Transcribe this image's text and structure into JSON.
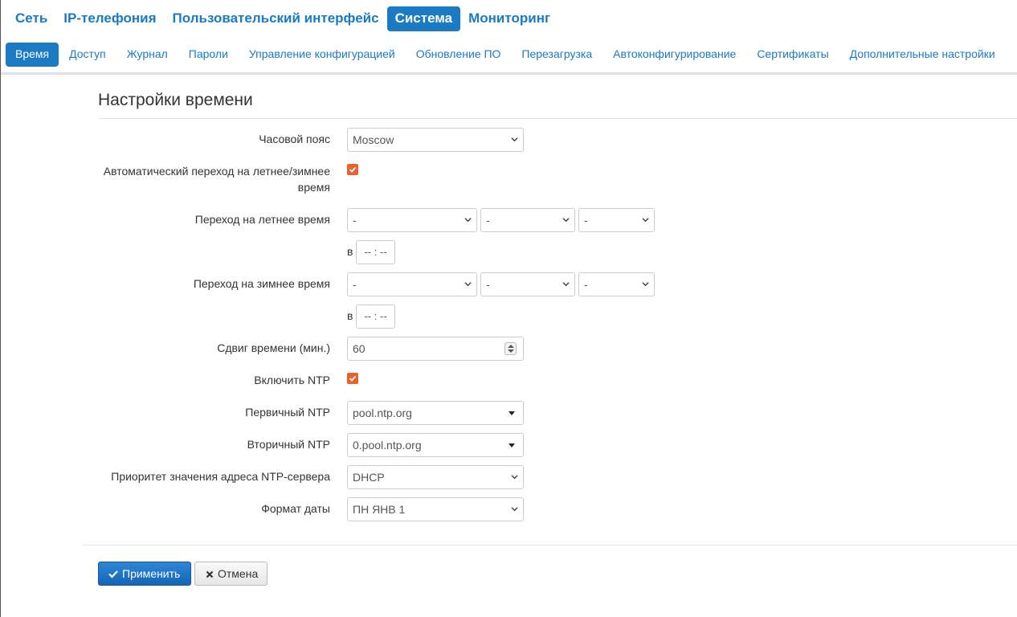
{
  "top_nav": [
    {
      "label": "Сеть",
      "active": false
    },
    {
      "label": "IP-телефония",
      "active": false
    },
    {
      "label": "Пользовательский интерфейс",
      "active": false
    },
    {
      "label": "Система",
      "active": true
    },
    {
      "label": "Мониторинг",
      "active": false
    }
  ],
  "sub_nav": [
    {
      "label": "Время",
      "active": true
    },
    {
      "label": "Доступ",
      "active": false
    },
    {
      "label": "Журнал",
      "active": false
    },
    {
      "label": "Пароли",
      "active": false
    },
    {
      "label": "Управление конфигурацией",
      "active": false
    },
    {
      "label": "Обновление ПО",
      "active": false
    },
    {
      "label": "Перезагрузка",
      "active": false
    },
    {
      "label": "Автоконфигурирование",
      "active": false
    },
    {
      "label": "Сертификаты",
      "active": false
    },
    {
      "label": "Дополнительные настройки",
      "active": false
    }
  ],
  "section": {
    "title": "Настройки времени"
  },
  "form": {
    "timezone": {
      "label": "Часовой пояс",
      "value": "Moscow"
    },
    "auto_dst": {
      "label": "Автоматический переход на летнее/зимнее время",
      "checked": true
    },
    "summer": {
      "label": "Переход на летнее время",
      "selects": [
        "-",
        "-",
        "-"
      ],
      "at_label": "в",
      "time": "-- : --"
    },
    "winter": {
      "label": "Переход на зимнее время",
      "selects": [
        "-",
        "-",
        "-"
      ],
      "at_label": "в",
      "time": "-- : --"
    },
    "offset": {
      "label": "Сдвиг времени (мин.)",
      "value": "60"
    },
    "ntp_enable": {
      "label": "Включить NTP",
      "checked": true
    },
    "primary_ntp": {
      "label": "Первичный NTP",
      "value": "pool.ntp.org"
    },
    "secondary_ntp": {
      "label": "Вторичный NTP",
      "value": "0.pool.ntp.org"
    },
    "ntp_priority": {
      "label": "Приоритет значения адреса NTP-сервера",
      "value": "DHCP"
    },
    "date_format": {
      "label": "Формат даты",
      "value": "ПН ЯНВ 1"
    }
  },
  "buttons": {
    "apply": "Применить",
    "cancel": "Отмена"
  },
  "colors": {
    "accent": "#1a7bc4",
    "checkbox": "#e8632c"
  }
}
